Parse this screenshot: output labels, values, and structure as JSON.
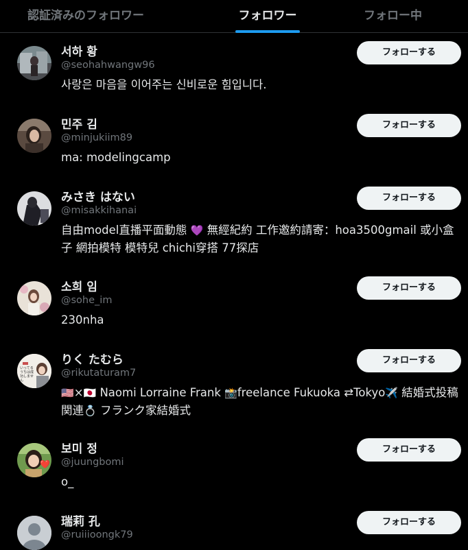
{
  "tabs": [
    {
      "label": "認証済みのフォロワー",
      "active": false
    },
    {
      "label": "フォロワー",
      "active": true
    },
    {
      "label": "フォロー中",
      "active": false
    }
  ],
  "follow_label": "フォローする",
  "users": [
    {
      "name": "서하 황",
      "handle": "@seohahwangw96",
      "bio": "사랑은 마음을 이어주는 신비로운 힘입니다."
    },
    {
      "name": "민주 김",
      "handle": "@minjukiim89",
      "bio": "ma: modelingcamp"
    },
    {
      "name": "みさき はない",
      "handle": "@misakkihanai",
      "bio_parts": [
        "自由model直播平面動態",
        "💜",
        "無經紀約 工作邀約請寄：hoa3500gmail 或小盒子 網拍模特 模特兒 chichi穿搭 77探店"
      ]
    },
    {
      "name": "소희 임",
      "handle": "@sohe_im",
      "bio": "230nha"
    },
    {
      "name": "りく たむら",
      "handle": "@rikutaturam7",
      "bio_parts": [
        "🇺🇸",
        "×",
        "🇯🇵",
        "Naomi Lorraine Frank ",
        "📸",
        "freelance Fukuoka ⇄Tokyo",
        "✈️",
        "結婚式投稿関連",
        "💍",
        "フランク家結婚式"
      ],
      "avatar_text": "いってるうちは成功しません"
    },
    {
      "name": "보미 정",
      "handle": "@juungbomi",
      "bio": "o_",
      "avatar_emoji": "❤️"
    },
    {
      "name": "瑞莉 孔",
      "handle": "@ruiiioongk79",
      "bio": ""
    }
  ]
}
